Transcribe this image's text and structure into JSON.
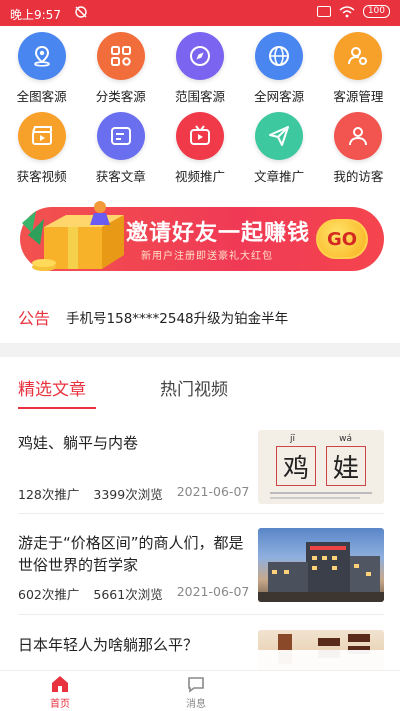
{
  "status_bar": {
    "time": "晚上9:57",
    "battery": "100"
  },
  "grid": {
    "row1": [
      {
        "label": "全图客源",
        "icon": "map-pin-icon",
        "color": "#4a86f0"
      },
      {
        "label": "分类客源",
        "icon": "category-grid-icon",
        "color": "#f26d3c"
      },
      {
        "label": "范围客源",
        "icon": "compass-icon",
        "color": "#7b65f0"
      },
      {
        "label": "全网客源",
        "icon": "globe-icon",
        "color": "#4a86f0"
      },
      {
        "label": "客源管理",
        "icon": "user-gear-icon",
        "color": "#f7a02a"
      }
    ],
    "row2": [
      {
        "label": "获客视频",
        "icon": "clapperboard-icon",
        "color": "#f7a02a"
      },
      {
        "label": "获客文章",
        "icon": "article-icon",
        "color": "#6a6ff0"
      },
      {
        "label": "视频推广",
        "icon": "tv-icon",
        "color": "#f03a4a"
      },
      {
        "label": "文章推广",
        "icon": "paper-plane-icon",
        "color": "#3ec8a0"
      },
      {
        "label": "我的访客",
        "icon": "visitor-icon",
        "color": "#f2544f"
      }
    ]
  },
  "banner": {
    "title": "邀请好友一起赚钱",
    "subtitle": "新用户注册即送豪礼大红包",
    "go_label": "GO"
  },
  "notice": {
    "tag": "公告",
    "text": "手机号158****2548升级为铂金半年"
  },
  "tabs": [
    {
      "label": "精选文章"
    },
    {
      "label": "热门视频"
    }
  ],
  "articles": [
    {
      "title": "鸡娃、躺平与内卷",
      "promotions": "128",
      "promotions_suffix": "次推广",
      "views": "3399",
      "views_suffix": "次浏览",
      "date": "2021-06-07",
      "thumb_chars": [
        "鸡",
        "娃"
      ],
      "thumb_pinyin": [
        "jī",
        "wá"
      ]
    },
    {
      "title": "游走于“价格区间”的商人们，都是世俗世界的哲学家",
      "promotions": "602",
      "promotions_suffix": "次推广",
      "views": "5661",
      "views_suffix": "次浏览",
      "date": "2021-06-07"
    },
    {
      "title": "日本年轻人为啥躺那么平？"
    }
  ],
  "bottom_nav": {
    "home_label": "首页",
    "msg_label": "消息"
  }
}
